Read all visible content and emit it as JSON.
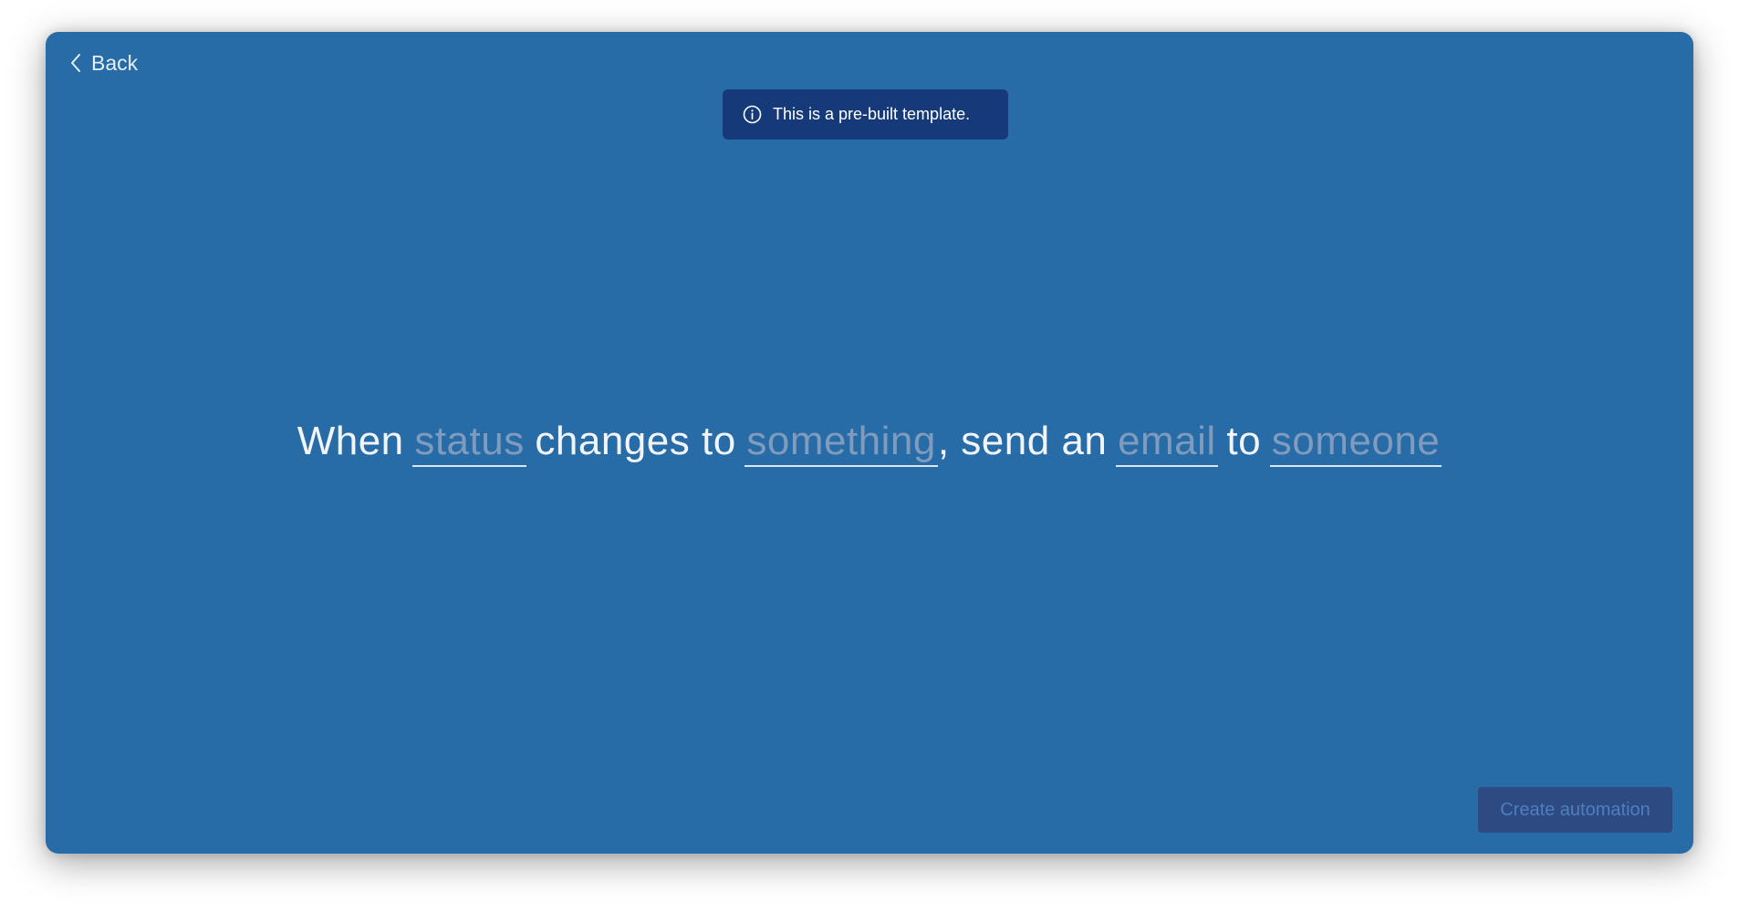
{
  "header": {
    "back_label": "Back",
    "back_icon": "chevron-left-icon"
  },
  "banner": {
    "icon": "info-icon",
    "text": "This is a pre-built template."
  },
  "sentence": {
    "part1": "When",
    "field_status": "status",
    "part2": "changes to",
    "field_value": "something",
    "part3": ", send an",
    "field_action": "email",
    "part4": "to",
    "field_recipient": "someone"
  },
  "footer": {
    "create_label": "Create automation"
  },
  "colors": {
    "background": "#276ba7",
    "banner": "#163a79",
    "placeholder": "#7f9bbd",
    "button": "#2d4a83"
  }
}
